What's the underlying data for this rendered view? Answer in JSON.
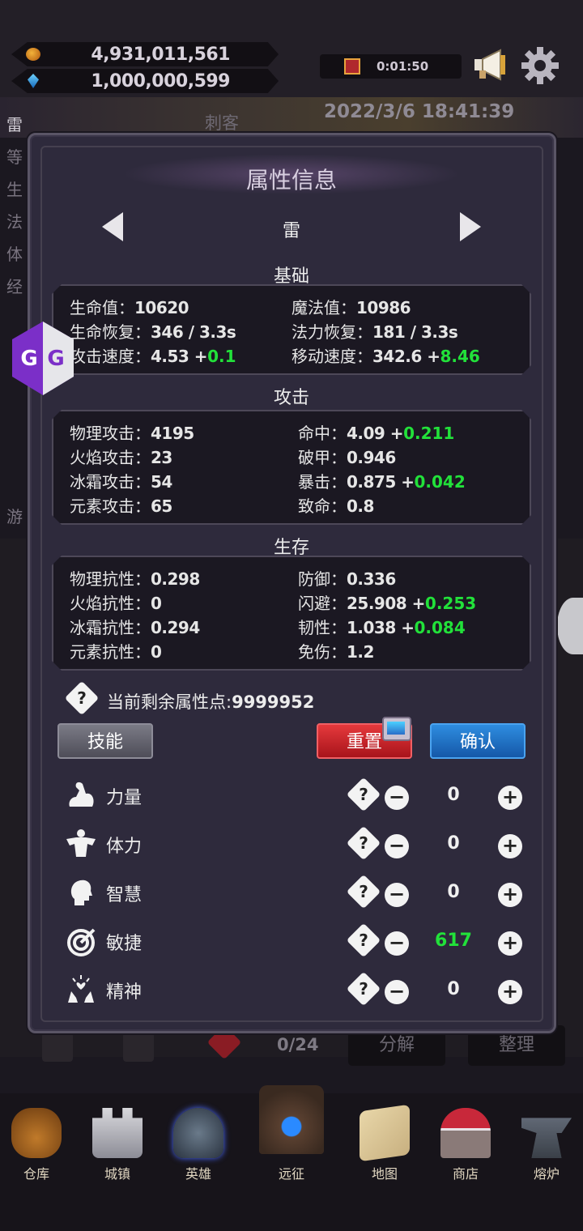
{
  "topbar": {
    "gold": "4,931,011,561",
    "gems": "1,000,000,599",
    "timer": "0:01:50",
    "icons": [
      "coin-icon",
      "gem-icon",
      "gift-icon",
      "megaphone-icon",
      "gear-icon"
    ]
  },
  "background": {
    "datetime": "2022/3/6 18:41:39",
    "class_name": "刺客",
    "side_chars": [
      "雷",
      "等",
      "生",
      "法",
      "体",
      "经",
      "游"
    ],
    "inventory_count": "0/24",
    "decompose_label": "分解",
    "sort_label": "整理"
  },
  "modal": {
    "title": "属性信息",
    "hero_name": "雷",
    "sections": {
      "basic": {
        "title": "基础",
        "rows": [
          {
            "label": "生命值：",
            "value": "10620",
            "label2": "魔法值：",
            "value2": "10986"
          },
          {
            "label": "生命恢复：",
            "value": "346 / 3.3s",
            "label2": "法力恢复：",
            "value2": "181 / 3.3s"
          },
          {
            "label": "攻击速度：",
            "value": "4.53 +",
            "bonus": "0.1",
            "label2": "移动速度：",
            "value2": "342.6 +",
            "bonus2": "8.46"
          }
        ]
      },
      "attack": {
        "title": "攻击",
        "rows": [
          {
            "label": "物理攻击：",
            "value": "4195",
            "label2": "命中：",
            "value2": "4.09 +",
            "bonus2": "0.211"
          },
          {
            "label": "火焰攻击：",
            "value": "23",
            "label2": "破甲：",
            "value2": "0.946"
          },
          {
            "label": "冰霜攻击：",
            "value": "54",
            "label2": "暴击：",
            "value2": "0.875 +",
            "bonus2": "0.042"
          },
          {
            "label": "元素攻击：",
            "value": "65",
            "label2": "致命：",
            "value2": "0.8"
          }
        ]
      },
      "survival": {
        "title": "生存",
        "rows": [
          {
            "label": "物理抗性：",
            "value": "0.298",
            "label2": "防御：",
            "value2": "0.336"
          },
          {
            "label": "火焰抗性：",
            "value": "0",
            "label2": "闪避：",
            "value2": "25.908 +",
            "bonus2": "0.253"
          },
          {
            "label": "冰霜抗性：",
            "value": "0.294",
            "label2": "韧性：",
            "value2": "1.038 +",
            "bonus2": "0.084"
          },
          {
            "label": "元素抗性：",
            "value": "0",
            "label2": "免伤：",
            "value2": "1.2"
          }
        ]
      }
    },
    "points_label": "当前剩余属性点:",
    "points_value": "9999952",
    "skill_button": "技能",
    "reset_button": "重置",
    "confirm_button": "确认",
    "attributes": [
      {
        "name": "力量",
        "value": "0",
        "icon": "muscle-arm-icon"
      },
      {
        "name": "体力",
        "value": "0",
        "icon": "muscle-torso-icon"
      },
      {
        "name": "智慧",
        "value": "0",
        "icon": "head-icon"
      },
      {
        "name": "敏捷",
        "value": "617",
        "icon": "target-icon"
      },
      {
        "name": "精神",
        "value": "0",
        "icon": "spirit-icon"
      }
    ]
  },
  "bottom_nav": [
    {
      "label": "仓库",
      "icon": "bag-icon"
    },
    {
      "label": "城镇",
      "icon": "castle-icon"
    },
    {
      "label": "英雄",
      "icon": "helmet-icon"
    },
    {
      "label": "远征",
      "icon": "portal-icon"
    },
    {
      "label": "地图",
      "icon": "map-icon"
    },
    {
      "label": "商店",
      "icon": "shop-icon"
    },
    {
      "label": "熔炉",
      "icon": "anvil-icon"
    }
  ]
}
